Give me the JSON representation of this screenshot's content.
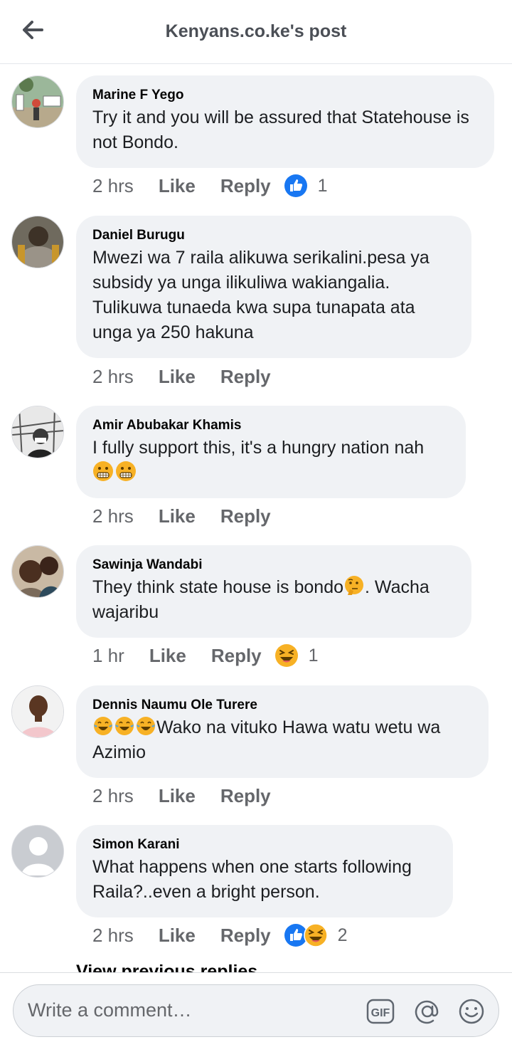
{
  "header": {
    "title": "Kenyans.co.ke's post",
    "back_icon": "arrow-left-icon"
  },
  "comments": [
    {
      "author": "Marine F Yego",
      "text": "Try it and you will be assured that Statehouse is not Bondo.",
      "time": "2 hrs",
      "like": "Like",
      "reply": "Reply",
      "reactions": [
        "like"
      ],
      "reaction_count": "1"
    },
    {
      "author": "Daniel Burugu",
      "text": "Mwezi wa 7 raila alikuwa serikalini.pesa ya subsidy ya unga ilikuliwa wakiangalia. Tulikuwa tunaeda kwa supa tunapata ata unga ya 250 hakuna",
      "time": "2 hrs",
      "like": "Like",
      "reply": "Reply"
    },
    {
      "author": "Amir Abubakar Khamis",
      "text": "I fully support this, it's a hungry nation nah",
      "emojis": [
        "grimacing-face-emoji",
        "grimacing-face-emoji"
      ],
      "time": "2 hrs",
      "like": "Like",
      "reply": "Reply"
    },
    {
      "author": "Sawinja Wandabi",
      "text_a": "They think state house is bondo",
      "emoji_mid": "thinking-face-emoji",
      "text_b": ". Wacha",
      "text_c": "wajaribu",
      "time": "1 hr",
      "like": "Like",
      "reply": "Reply",
      "reactions": [
        "haha"
      ],
      "reaction_count": "1"
    },
    {
      "author": "Dennis Naumu Ole Turere",
      "emojis": [
        "tears-of-joy-emoji",
        "tears-of-joy-emoji",
        "tears-of-joy-emoji"
      ],
      "text_a": "Wako na vituko Hawa watu wetu wa",
      "text_b": "Azimio",
      "time": "2 hrs",
      "like": "Like",
      "reply": "Reply"
    },
    {
      "author": "Simon Karani",
      "text": "What happens when one starts following Raila?..even a bright person.",
      "time": "2 hrs",
      "like": "Like",
      "reply": "Reply",
      "reactions": [
        "like",
        "haha"
      ],
      "reaction_count": "2"
    }
  ],
  "view_more": "View previous replies",
  "composer": {
    "placeholder": "Write a comment…",
    "gif_label": "GIF",
    "tools": [
      "gif-icon",
      "at-mention-icon",
      "smiley-icon"
    ]
  },
  "colors": {
    "like_blue": "#1877f2",
    "haha_yellow": "#f7b125",
    "bubble": "#f0f2f5",
    "secondary_text": "#65676b"
  }
}
